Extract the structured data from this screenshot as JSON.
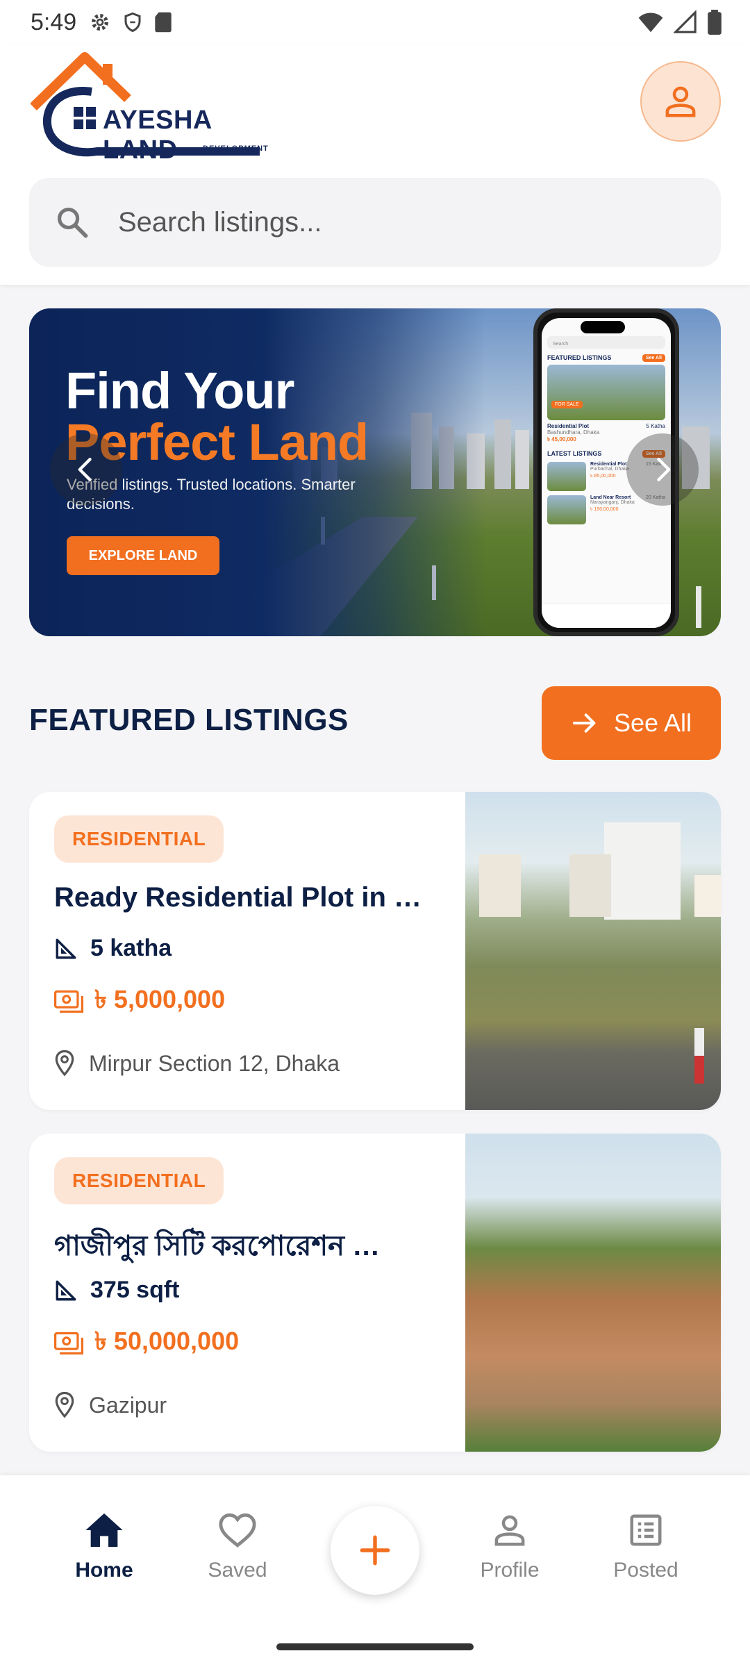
{
  "status_bar": {
    "time": "5:49"
  },
  "header": {
    "logo_name": "AYESHA LAND",
    "logo_sub": "DEVELOPMENT",
    "search_placeholder": "Search listings..."
  },
  "banner": {
    "title_line1": "Find Your",
    "title_line2": "Perfect Land",
    "subtitle": "Verified listings. Trusted locations. Smarter decisions.",
    "cta": "EXPLORE LAND",
    "phone": {
      "search": "Search",
      "featured": "FEATURED LISTINGS",
      "see_all": "See All",
      "for_sale": "FOR SALE",
      "card_title": "Residential Plot",
      "card_loc": "Bashundhara, Dhaka",
      "card_size": "5 Katha",
      "card_price": "৳ 45,00,000",
      "latest": "LATEST LISTINGS",
      "item1_title": "Residential Plot",
      "item1_loc": "Purbachal, Dhaka",
      "item1_size": "15 Katha",
      "item1_price": "৳ 85,00,000",
      "item2_title": "Land Near Resort",
      "item2_loc": "Narayanganj, Dhaka",
      "item2_size": "20 Katha",
      "item2_price": "৳ 150,00,000"
    }
  },
  "featured": {
    "title": "FEATURED LISTINGS",
    "see_all": "See All",
    "listings": [
      {
        "badge": "RESIDENTIAL",
        "title": "Ready Residential Plot in …",
        "size": "5 katha",
        "price": "৳ 5,000,000",
        "location": "Mirpur Section 12, Dhaka"
      },
      {
        "badge": "RESIDENTIAL",
        "title": "গাজীপুর সিটি করপোরেশন …",
        "size": "375 sqft",
        "price": "৳ 50,000,000",
        "location": "Gazipur"
      }
    ]
  },
  "bottom_nav": {
    "home": "Home",
    "saved": "Saved",
    "profile": "Profile",
    "posted": "Posted"
  },
  "colors": {
    "accent": "#f26f1f",
    "navy": "#0d1f44",
    "badge_bg": "#fde5d6"
  }
}
